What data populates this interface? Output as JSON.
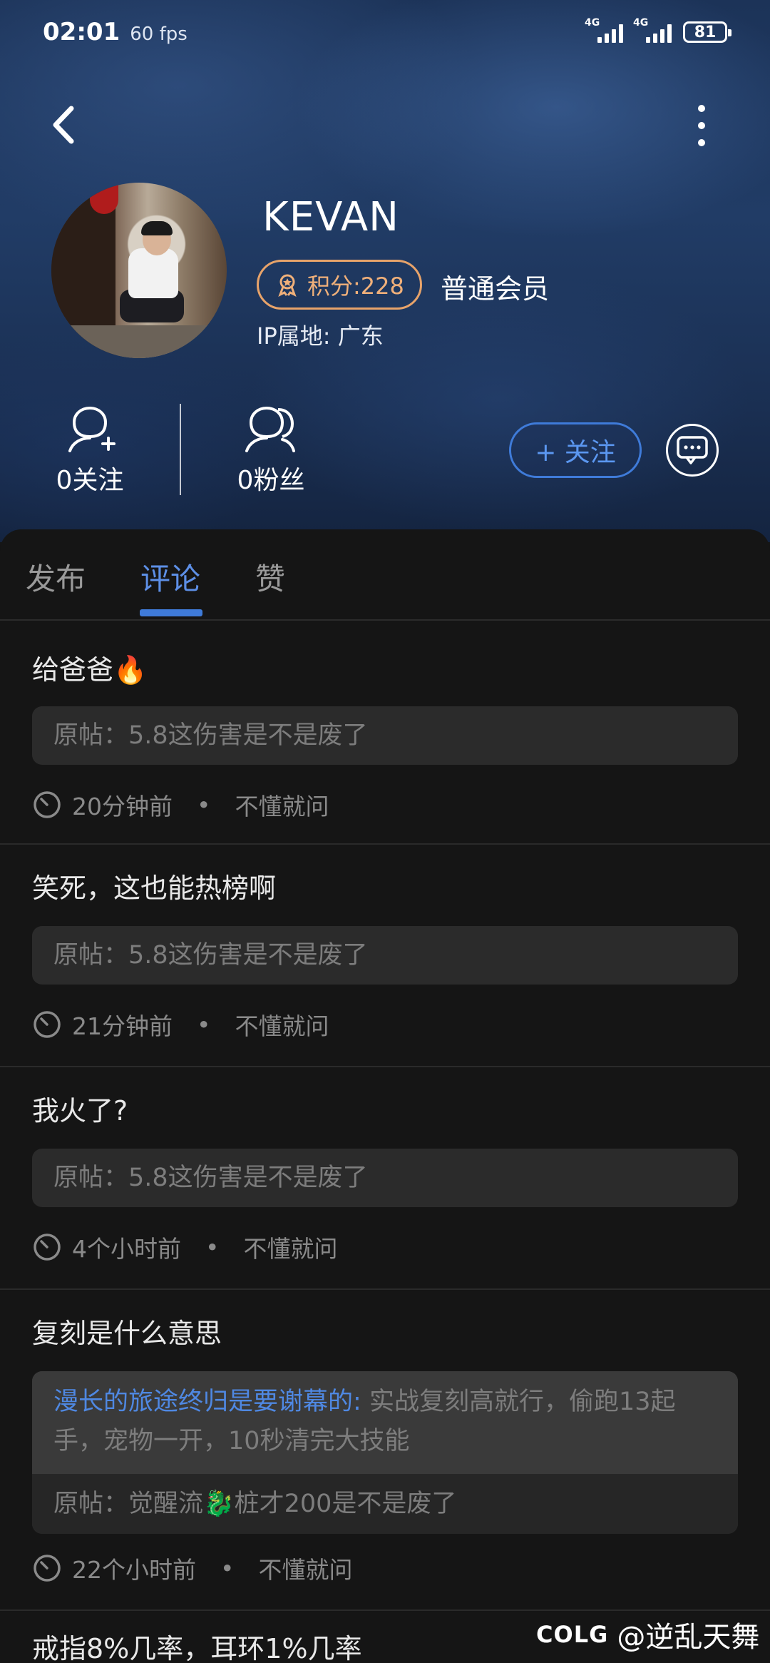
{
  "status_bar": {
    "time": "02:01",
    "fps": "60 fps",
    "net1": "4G",
    "net2": "4G",
    "battery": "81"
  },
  "profile": {
    "username": "KEVAN",
    "points_label": "积分:228",
    "member_level": "普通会员",
    "ip_location": "IP属地: 广东",
    "following": "0关注",
    "followers": "0粉丝",
    "follow_button": "+ 关注"
  },
  "tabs": [
    {
      "label": "发布"
    },
    {
      "label": "评论"
    },
    {
      "label": "赞"
    }
  ],
  "active_tab": "评论",
  "comments": [
    {
      "text": "给爸爸🔥",
      "original_post": "原帖：5.8这伤害是不是废了",
      "time": "20分钟前",
      "board": "不懂就问"
    },
    {
      "text": "笑死，这也能热榜啊",
      "original_post": "原帖：5.8这伤害是不是废了",
      "time": "21分钟前",
      "board": "不懂就问"
    },
    {
      "text": "我火了?",
      "original_post": "原帖：5.8这伤害是不是废了",
      "time": "4个小时前",
      "board": "不懂就问"
    },
    {
      "text": "复刻是什么意思",
      "reply_to": "漫长的旅途终归是要谢幕的:",
      "reply_text": "实战复刻高就行，偷跑13起手，宠物一开，10秒清完大技能",
      "original_post": "原帖：觉醒流🐉桩才200是不是废了",
      "time": "22个小时前",
      "board": "不懂就问"
    },
    {
      "text": "戒指8%几率，耳环1%几率"
    }
  ],
  "watermark": {
    "logo": "COLG",
    "name": "@逆乱天舞"
  },
  "colors": {
    "accent": "#3f7bd9",
    "points": "#e7a36a",
    "background": "#151515"
  }
}
